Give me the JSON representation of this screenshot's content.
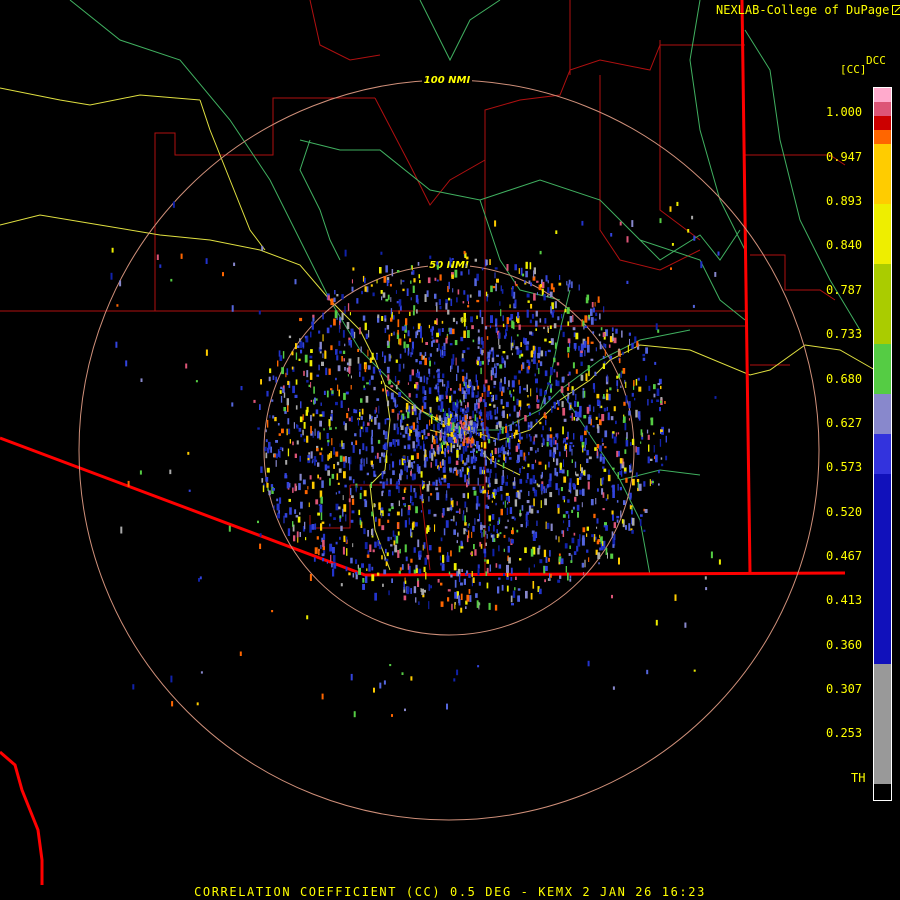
{
  "header": {
    "credit": "NEXLAB-College of DuPage",
    "product_code": "DCC",
    "product_unit": "[CC]"
  },
  "range_rings": [
    {
      "label": "100 NMI"
    },
    {
      "label": "50 NMI"
    }
  ],
  "colorbar": {
    "labels": [
      "1.000",
      "0.947",
      "0.893",
      "0.840",
      "0.787",
      "0.733",
      "0.680",
      "0.627",
      "0.573",
      "0.520",
      "0.467",
      "0.413",
      "0.360",
      "0.307",
      "0.253",
      "TH"
    ],
    "colors": [
      "#ffaacc",
      "#dd5577",
      "#cc0000",
      "#ff6600",
      "#ffcc00",
      "#eeee00",
      "#aacc00",
      "#55cc44",
      "#8888cc",
      "#3333dd",
      "#1111bb",
      "#999999",
      "#000000"
    ]
  },
  "footer": {
    "caption": "CORRELATION COEFFICIENT (CC) 0.5 DEG - KEMX 2 JAN 26 16:23"
  }
}
